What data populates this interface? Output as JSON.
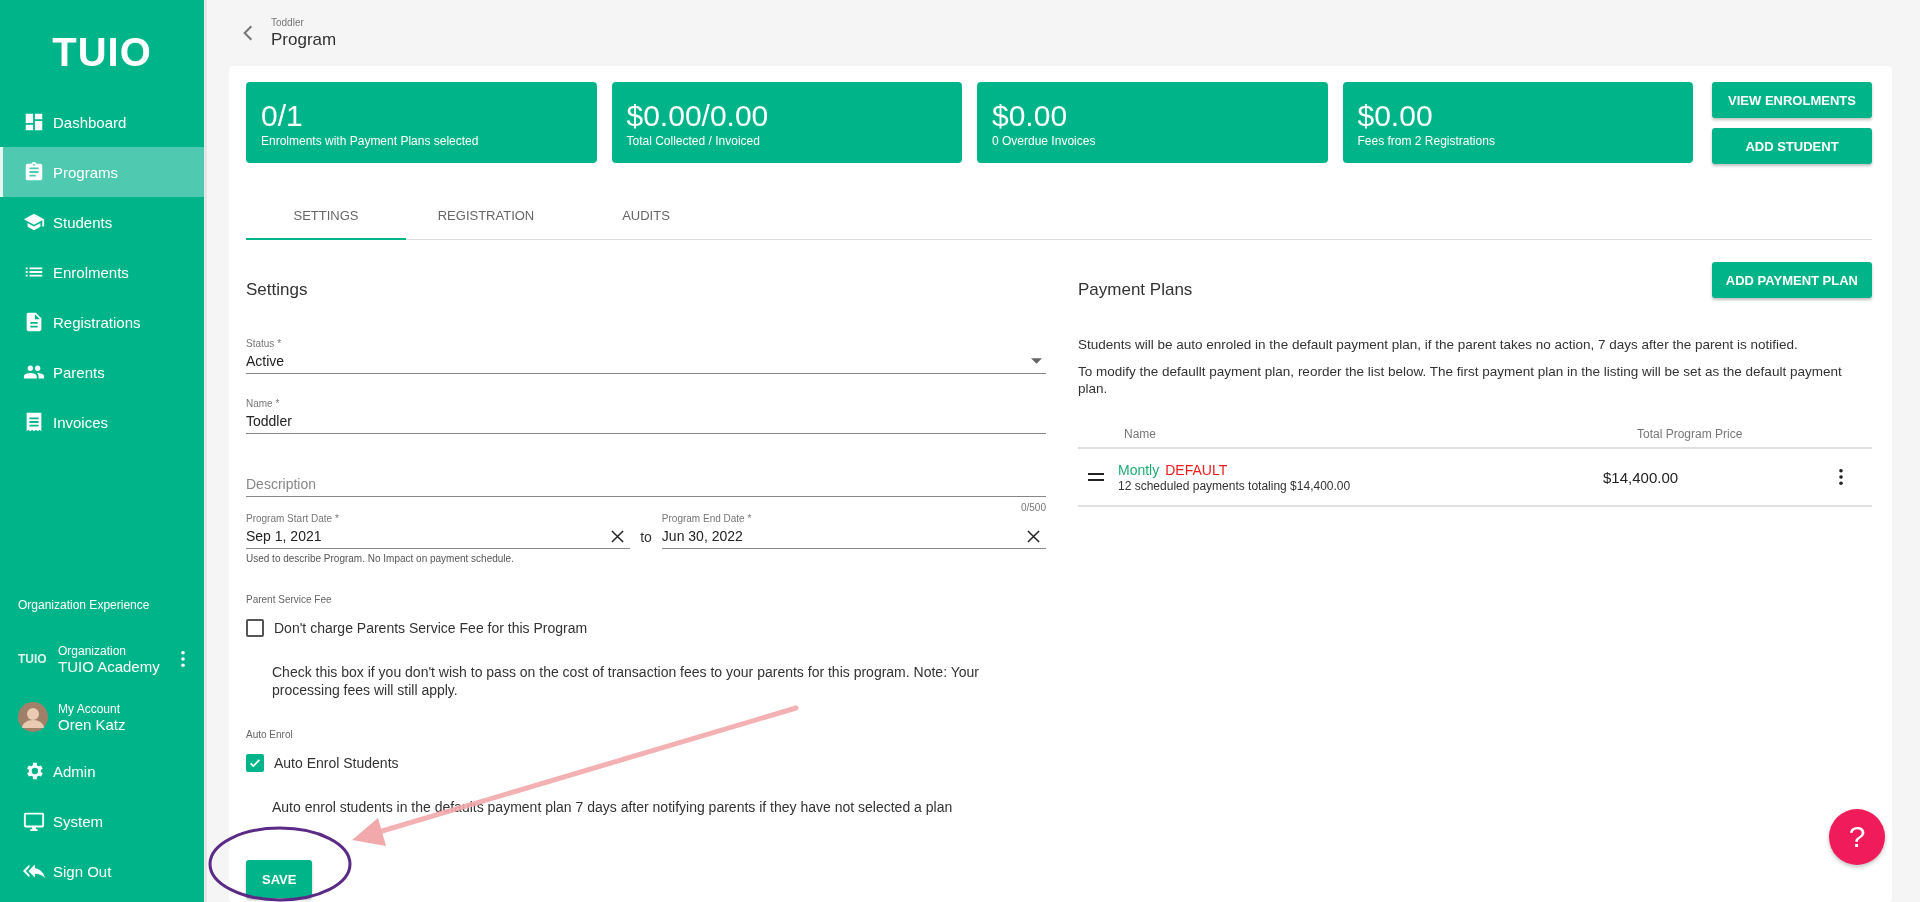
{
  "sidebar": {
    "logo": "TUIO",
    "items": [
      {
        "label": "Dashboard",
        "kind": "dashboard",
        "selected": false
      },
      {
        "label": "Programs",
        "kind": "clipboard",
        "selected": true
      },
      {
        "label": "Students",
        "kind": "cap",
        "selected": false
      },
      {
        "label": "Enrolments",
        "kind": "list",
        "selected": false
      },
      {
        "label": "Registrations",
        "kind": "document",
        "selected": false
      },
      {
        "label": "Parents",
        "kind": "people",
        "selected": false
      },
      {
        "label": "Invoices",
        "kind": "receipt",
        "selected": false
      }
    ],
    "org_heading": "Organization Experience",
    "organization": {
      "logo": "TUIO",
      "label": "Organization",
      "name": "TUIO Academy"
    },
    "account": {
      "label": "My Account",
      "name": "Oren Katz"
    },
    "bottom_items": [
      {
        "label": "Admin",
        "kind": "gear"
      },
      {
        "label": "System",
        "kind": "monitor"
      },
      {
        "label": "Sign Out",
        "kind": "signout"
      }
    ]
  },
  "header": {
    "breadcrumb": "Toddler",
    "title": "Program"
  },
  "stats": [
    {
      "value": "0/1",
      "caption": "Enrolments with Payment Plans selected"
    },
    {
      "value": "$0.00/0.00",
      "caption": "Total Collected / Invoiced"
    },
    {
      "value": "$0.00",
      "caption": "0 Overdue Invoices"
    },
    {
      "value": "$0.00",
      "caption": "Fees from 2 Registrations"
    }
  ],
  "actions": [
    "VIEW ENROLMENTS",
    "ADD STUDENT"
  ],
  "tabs": [
    {
      "label": "SETTINGS",
      "selected": true
    },
    {
      "label": "REGISTRATION",
      "selected": false
    },
    {
      "label": "AUDITS",
      "selected": false
    }
  ],
  "settings": {
    "heading": "Settings",
    "status": {
      "label": "Status *",
      "value": "Active"
    },
    "name": {
      "label": "Name *",
      "value": "Toddler"
    },
    "description": {
      "placeholder": "Description",
      "counter": "0/500"
    },
    "start_date": {
      "label": "Program Start Date *",
      "value": "Sep 1, 2021"
    },
    "separator": "to",
    "end_date": {
      "label": "Program End Date *",
      "value": "Jun 30, 2022"
    },
    "date_helper": "Used to describe Program. No Impact on payment schedule.",
    "options": [
      {
        "section": "Parent Service Fee",
        "label": "Don't charge Parents Service Fee for this Program",
        "checked": false,
        "description": "Check this box if you don't wish to pass on the cost of transaction fees to your parents for this program. Note: Your processing fees will still apply."
      },
      {
        "section": "Auto Enrol",
        "label": "Auto Enrol Students",
        "checked": true,
        "description": "Auto enrol students in the defaults payment plan 7 days after notifying parents if they have not selected a plan"
      }
    ],
    "save_button": "SAVE"
  },
  "payment_plans": {
    "heading": "Payment Plans",
    "add_button": "ADD PAYMENT PLAN",
    "notes": [
      "Students will be auto enroled in the default payment plan, if the parent takes no action, 7 days after the parent is notified.",
      "To modify the defaullt payment plan, reorder the list below. The first payment plan in the listing will be set as the default payment plan."
    ],
    "columns": [
      "Name",
      "Total Program Price"
    ],
    "rows": [
      {
        "name": "Montly",
        "badge": "DEFAULT",
        "details": "12 scheduled payments totaling $14,400.00",
        "price": "$14,400.00"
      }
    ]
  },
  "help_button": "?"
}
